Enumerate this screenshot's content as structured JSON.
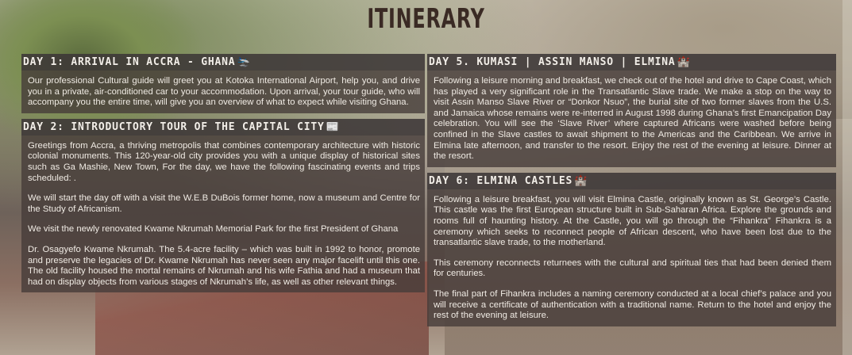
{
  "title": "ITINERARY",
  "days": [
    {
      "heading": "DAY 1: ARRIVAL IN ACCRA - GHANA",
      "icon": "plane-landing-icon",
      "icon_glyph": "🛬",
      "paragraphs": [
        "Our professional Cultural guide will greet you at Kotoka International Airport, help you, and drive you in a private, air-conditioned car to your accommodation. Upon arrival, your tour guide, who will accompany you the entire time, will give you an overview of what to expect while visiting Ghana."
      ]
    },
    {
      "heading": "DAY 2: INTRODUCTORY TOUR OF THE CAPITAL CITY",
      "icon": "newspaper-icon",
      "icon_glyph": "📰",
      "paragraphs": [
        "Greetings from Accra, a thriving metropolis that combines contemporary architecture with historic colonial monuments. This 120-year-old city provides you with a unique display of historical sites such as Ga Mashie, New Town, For the day, we have the following fascinating events and trips scheduled: .",
        "We will start the day off with a visit the W.E.B DuBois former home, now a museum and Centre for the Study of Africanism.",
        "We visit the newly renovated Kwame Nkrumah Memorial Park for the first President of Ghana",
        "Dr. Osagyefo Kwame Nkrumah. The 5.4-acre facility – which was built in 1992 to honor, promote and preserve the legacies of Dr. Kwame Nkrumah has never seen any major facelift until this one. The old facility housed the mortal remains of Nkrumah and his wife Fathia and had a museum that had on display objects from various stages of Nkrumah’s life, as well as other relevant things."
      ]
    },
    {
      "heading": "DAY 5. KUMASI | ASSIN MANSO | ELMINA",
      "icon": "castle-icon",
      "icon_glyph": "🏰",
      "paragraphs": [
        "Following a leisure morning and breakfast, we check out of the hotel and drive to Cape Coast, which has played a very significant role in the Transatlantic Slave trade. We make a stop on the way to visit Assin Manso Slave River or “Donkor Nsuo”, the burial site of two former slaves from the U.S. and Jamaica whose remains were re-interred in August 1998 during Ghana’s first Emancipation Day celebration. You will see the ‘Slave River’ where captured Africans were washed before being confined in the Slave castles to await shipment to the Americas and the Caribbean. We arrive in Elmina late afternoon, and transfer to the resort. Enjoy the rest of the evening at leisure. Dinner at the resort."
      ]
    },
    {
      "heading": "DAY 6: ELMINA CASTLES",
      "icon": "castle-icon",
      "icon_glyph": "🏰",
      "paragraphs": [
        "Following a leisure breakfast, you will visit Elmina Castle, originally known as St. George’s Castle. This castle was the first European structure built in Sub-Saharan Africa. Explore the grounds and rooms full of haunting history. At the Castle, you will go through the “Fihankra” Fihankra is a ceremony which seeks to reconnect people of African descent, who have been lost due to the transatlantic slave trade, to the motherland.",
        "This ceremony reconnects returnees with the cultural and spiritual ties that had been denied them for centuries.",
        "The final part of Fihankra includes a naming ceremony conducted at a local chief’s palace and you will receive a certificate of authentication with a traditional name. Return to the hotel and enjoy the rest of the evening at leisure."
      ]
    }
  ]
}
